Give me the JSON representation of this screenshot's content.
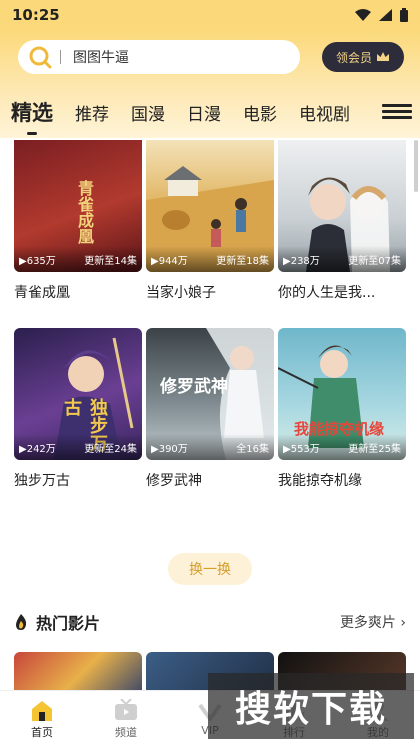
{
  "status": {
    "time": "10:25"
  },
  "search": {
    "text": "图图牛逼"
  },
  "vip": {
    "label": "领会员"
  },
  "tabs": [
    {
      "label": "精选"
    },
    {
      "label": "推荐"
    },
    {
      "label": "国漫"
    },
    {
      "label": "日漫"
    },
    {
      "label": "电影"
    },
    {
      "label": "电视剧"
    }
  ],
  "row1": [
    {
      "title": "青雀成凰",
      "views": "635万",
      "update": "更新至14集",
      "art_text": "青雀成凰",
      "colors": [
        "#7a1e22",
        "#b23a2e"
      ]
    },
    {
      "title": "当家小娘子",
      "views": "944万",
      "update": "更新至18集",
      "art_text": "",
      "colors": [
        "#e8c272",
        "#c8913d"
      ]
    },
    {
      "title": "你的人生是我...",
      "views": "238万",
      "update": "更新至07集",
      "art_text": "",
      "colors": [
        "#dfe3e6",
        "#a9b4bb"
      ]
    }
  ],
  "row2": [
    {
      "title": "独步万古",
      "views": "242万",
      "update": "更新至24集",
      "art_text": "独步万古",
      "colors": [
        "#3b2a63",
        "#7c4ea3"
      ]
    },
    {
      "title": "修罗武神",
      "views": "390万",
      "update": "全16集",
      "art_text": "修罗武神",
      "colors": [
        "#4a5257",
        "#8e9ba0"
      ]
    },
    {
      "title": "我能掠夺机缘",
      "views": "553万",
      "update": "更新至25集",
      "art_text": "我能掠夺机缘",
      "colors": [
        "#5ea2b8",
        "#a6d4de"
      ]
    }
  ],
  "refresh": {
    "label": "换一换"
  },
  "hot": {
    "title": "热门影片",
    "more": "更多爽片",
    "thumbs": [
      [
        "#c7463c",
        "#2c3e6b"
      ],
      [
        "#3c5e86",
        "#1f2d44"
      ],
      [
        "#111111",
        "#5b3a2a"
      ]
    ]
  },
  "nav": [
    {
      "label": "首页"
    },
    {
      "label": "频道"
    },
    {
      "label": "VIP"
    },
    {
      "label": "排行"
    },
    {
      "label": "我的"
    }
  ],
  "watermark": {
    "text": "搜软下载"
  }
}
